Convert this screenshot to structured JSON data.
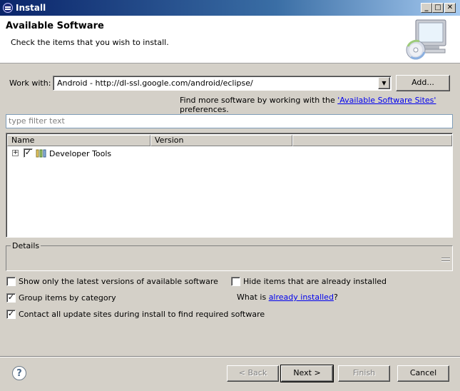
{
  "window": {
    "title": "Install",
    "minimize_icon": "minimize-icon",
    "maximize_icon": "maximize-icon",
    "close_icon": "close-icon"
  },
  "header": {
    "title": "Available Software",
    "subtitle": "Check the items that you wish to install.",
    "banner_icon": "install-wizard-icon"
  },
  "work_with": {
    "label": "Work with:",
    "value": "Android - http://dl-ssl.google.com/android/eclipse/",
    "add_button": "Add...",
    "hint_prefix": "Find more software by working with the ",
    "hint_link": "'Available Software Sites'",
    "hint_suffix": " preferences."
  },
  "filter": {
    "placeholder": "type filter text"
  },
  "tree": {
    "columns": [
      "Name",
      "Version"
    ],
    "rows": [
      {
        "label": "Developer Tools",
        "version": "",
        "checked": true,
        "expanded": false
      }
    ]
  },
  "details": {
    "label": "Details"
  },
  "options": {
    "show_latest": {
      "label": "Show only the latest versions of available software",
      "checked": false
    },
    "hide_installed": {
      "label": "Hide items that are already installed",
      "checked": false
    },
    "group_by_category": {
      "label": "Group items by category",
      "checked": true
    },
    "contact_sites": {
      "label": "Contact all update sites during install to find required software",
      "checked": true
    },
    "what_is_prefix": "What is ",
    "what_is_link": "already installed",
    "what_is_suffix": "?"
  },
  "buttons": {
    "help_icon": "help-icon",
    "back": "< Back",
    "next": "Next >",
    "finish": "Finish",
    "cancel": "Cancel"
  }
}
